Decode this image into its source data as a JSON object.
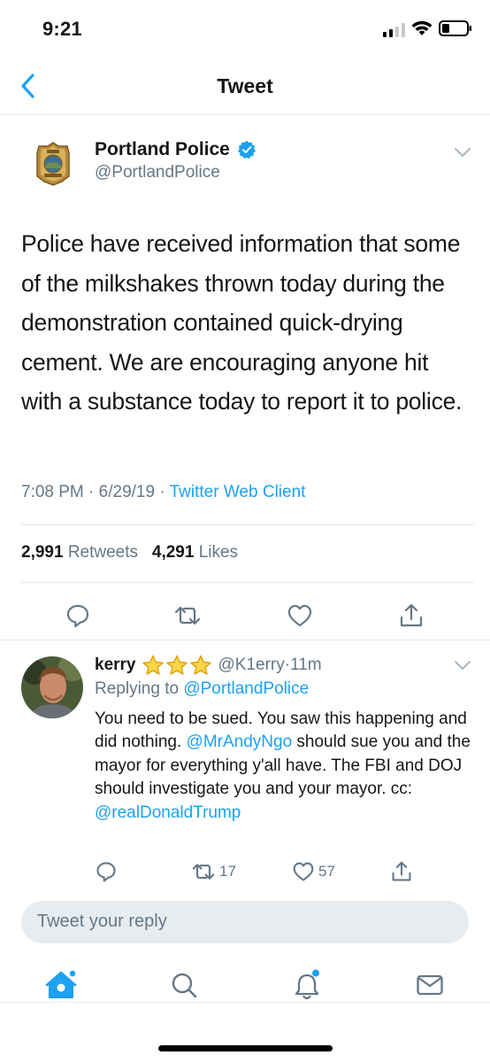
{
  "status_bar": {
    "time": "9:21"
  },
  "nav": {
    "title": "Tweet"
  },
  "tweet": {
    "author_name": "Portland Police",
    "author_handle": "@PortlandPolice",
    "text": "Police have received information that some of the milkshakes thrown today during the demonstration contained quick-drying cement. We are encouraging anyone hit with a substance today to report it to police.",
    "time": "7:08 PM",
    "date": "6/29/19",
    "client": "Twitter Web Client",
    "retweets_count": "2,991",
    "retweets_label": "Retweets",
    "likes_count": "4,291",
    "likes_label": "Likes"
  },
  "reply": {
    "author_name": "kerry",
    "author_handle": "@K1erry",
    "age": "11m",
    "replying_to_label": "Replying to",
    "replying_to_handle": "@PortlandPolice",
    "text_part1": "You need to be sued. You saw this happening and did nothing. ",
    "mention1": "@MrAndyNgo",
    "text_part2": " should sue you and the mayor for everything y'all have. The FBI and DOJ should investigate you and your mayor. cc: ",
    "mention2": "@realDonaldTrump",
    "retweets": "17",
    "likes": "57"
  },
  "compose": {
    "placeholder": "Tweet your reply"
  },
  "colors": {
    "accent": "#1da1f2",
    "muted": "#657786",
    "divider": "#e1e8ed",
    "text": "#14171a",
    "star": "#f5c518"
  },
  "icons": {
    "back": "chevron-left-icon",
    "verified": "verified-badge-icon",
    "more": "chevron-down-icon",
    "reply": "comment-icon",
    "retweet": "retweet-icon",
    "like": "heart-icon",
    "share": "share-icon",
    "home": "home-icon",
    "search": "search-icon",
    "notifications": "bell-icon",
    "messages": "envelope-icon"
  }
}
